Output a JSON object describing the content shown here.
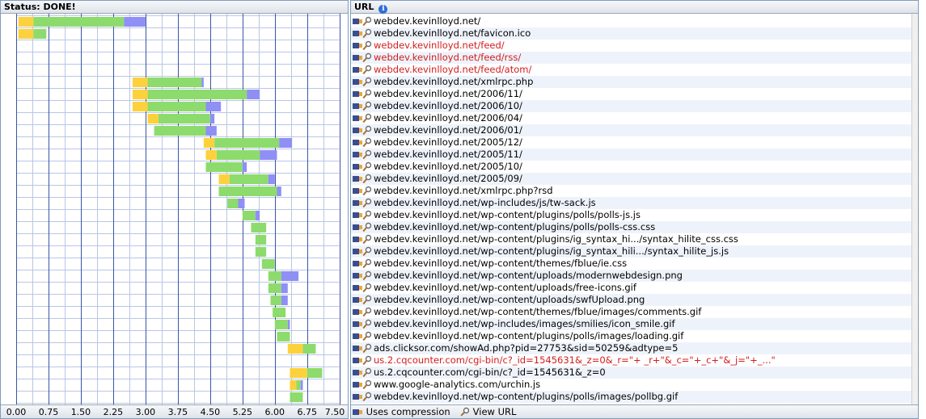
{
  "chart_header": {
    "status_label": "Status: DONE!"
  },
  "url_header": {
    "label": "URL",
    "info_icon": "info-icon"
  },
  "colors": {
    "wait": "#fdd13c",
    "receive": "#8ddb6c",
    "cache": "#8f8ff5",
    "grid": "#3c55a6",
    "row_alt": "#eef3fb",
    "error_text": "#d21d1d"
  },
  "legend": {
    "compression_label": "Uses compression",
    "view_label": "View URL"
  },
  "chart_data": {
    "type": "bar",
    "orientation": "horizontal-stacked-waterfall",
    "x_ticks": [
      "0.00",
      "0.75",
      "1.50",
      "2.25",
      "3.00",
      "3.75",
      "4.50",
      "5.25",
      "6.00",
      "6.75",
      "7.50"
    ],
    "xlim": [
      0,
      7.5
    ],
    "x_unit": "seconds",
    "segments": [
      "wait",
      "receive",
      "cache"
    ],
    "bars": [
      [
        0.05,
        0.35,
        2.1,
        0.5
      ],
      [
        0.05,
        0.35,
        0.3,
        0.0
      ],
      [
        0,
        0,
        0,
        0
      ],
      [
        0,
        0,
        0,
        0
      ],
      [
        0,
        0,
        0,
        0
      ],
      [
        2.7,
        0.35,
        1.25,
        0.05
      ],
      [
        2.7,
        0.35,
        2.3,
        0.3
      ],
      [
        2.7,
        0.35,
        1.35,
        0.35
      ],
      [
        3.05,
        0.25,
        1.2,
        0.1
      ],
      [
        3.2,
        0.0,
        1.2,
        0.25
      ],
      [
        4.35,
        0.25,
        1.5,
        0.3
      ],
      [
        4.4,
        0.25,
        1.0,
        0.4
      ],
      [
        4.4,
        0.0,
        0.85,
        0.1
      ],
      [
        4.7,
        0.25,
        0.9,
        0.15
      ],
      [
        4.7,
        0.0,
        1.35,
        0.1
      ],
      [
        4.9,
        0.0,
        0.25,
        0.15
      ],
      [
        5.25,
        0.0,
        0.3,
        0.1
      ],
      [
        5.45,
        0.0,
        0.35,
        0.0
      ],
      [
        5.55,
        0.0,
        0.25,
        0.0
      ],
      [
        5.55,
        0.0,
        0.25,
        0.0
      ],
      [
        5.7,
        0.0,
        0.3,
        0.0
      ],
      [
        5.85,
        0.0,
        0.3,
        0.4
      ],
      [
        5.85,
        0.0,
        0.3,
        0.15
      ],
      [
        5.9,
        0.0,
        0.25,
        0.15
      ],
      [
        5.95,
        0.0,
        0.3,
        0.0
      ],
      [
        6.0,
        0.0,
        0.3,
        0.05
      ],
      [
        6.05,
        0.0,
        0.3,
        0.0
      ],
      [
        6.3,
        0.35,
        0.3,
        0.0
      ],
      [
        0,
        0,
        0,
        0
      ],
      [
        6.35,
        0.4,
        0.35,
        0.0
      ],
      [
        6.35,
        0.15,
        0.1,
        0.05
      ],
      [
        6.35,
        0.0,
        0.3,
        0.0
      ]
    ]
  },
  "urls": [
    {
      "text": "webdev.kevinlloyd.net/",
      "error": false
    },
    {
      "text": "webdev.kevinlloyd.net/favicon.ico",
      "error": false
    },
    {
      "text": "webdev.kevinlloyd.net/feed/",
      "error": true
    },
    {
      "text": "webdev.kevinlloyd.net/feed/rss/",
      "error": true
    },
    {
      "text": "webdev.kevinlloyd.net/feed/atom/",
      "error": true
    },
    {
      "text": "webdev.kevinlloyd.net/xmlrpc.php",
      "error": false
    },
    {
      "text": "webdev.kevinlloyd.net/2006/11/",
      "error": false
    },
    {
      "text": "webdev.kevinlloyd.net/2006/10/",
      "error": false
    },
    {
      "text": "webdev.kevinlloyd.net/2006/04/",
      "error": false
    },
    {
      "text": "webdev.kevinlloyd.net/2006/01/",
      "error": false
    },
    {
      "text": "webdev.kevinlloyd.net/2005/12/",
      "error": false
    },
    {
      "text": "webdev.kevinlloyd.net/2005/11/",
      "error": false
    },
    {
      "text": "webdev.kevinlloyd.net/2005/10/",
      "error": false
    },
    {
      "text": "webdev.kevinlloyd.net/2005/09/",
      "error": false
    },
    {
      "text": "webdev.kevinlloyd.net/xmlrpc.php?rsd",
      "error": false
    },
    {
      "text": "webdev.kevinlloyd.net/wp-includes/js/tw-sack.js",
      "error": false
    },
    {
      "text": "webdev.kevinlloyd.net/wp-content/plugins/polls/polls-js.js",
      "error": false
    },
    {
      "text": "webdev.kevinlloyd.net/wp-content/plugins/polls/polls-css.css",
      "error": false
    },
    {
      "text": "webdev.kevinlloyd.net/wp-content/plugins/ig_syntax_hi.../syntax_hilite_css.css",
      "error": false
    },
    {
      "text": "webdev.kevinlloyd.net/wp-content/plugins/ig_syntax_hili.../syntax_hilite_js.js",
      "error": false
    },
    {
      "text": "webdev.kevinlloyd.net/wp-content/themes/fblue/ie.css",
      "error": false
    },
    {
      "text": "webdev.kevinlloyd.net/wp-content/uploads/modernwebdesign.png",
      "error": false
    },
    {
      "text": "webdev.kevinlloyd.net/wp-content/uploads/free-icons.gif",
      "error": false
    },
    {
      "text": "webdev.kevinlloyd.net/wp-content/uploads/swfUpload.png",
      "error": false
    },
    {
      "text": "webdev.kevinlloyd.net/wp-content/themes/fblue/images/comments.gif",
      "error": false
    },
    {
      "text": "webdev.kevinlloyd.net/wp-includes/images/smilies/icon_smile.gif",
      "error": false
    },
    {
      "text": "webdev.kevinlloyd.net/wp-content/plugins/polls/images/loading.gif",
      "error": false
    },
    {
      "text": "ads.clicksor.com/showAd.php?pid=27753&sid=50259&adtype=5",
      "error": false
    },
    {
      "text": "us.2.cqcounter.com/cgi-bin/c?_id=1545631&_z=0&_r=\"+ _r+\"&_c=\"+_c+\"&_j=\"+_...\"",
      "error": true
    },
    {
      "text": "us.2.cqcounter.com/cgi-bin/c?_id=1545631&_z=0",
      "error": false
    },
    {
      "text": "www.google-analytics.com/urchin.js",
      "error": false
    },
    {
      "text": "webdev.kevinlloyd.net/wp-content/plugins/polls/images/pollbg.gif",
      "error": false
    }
  ]
}
